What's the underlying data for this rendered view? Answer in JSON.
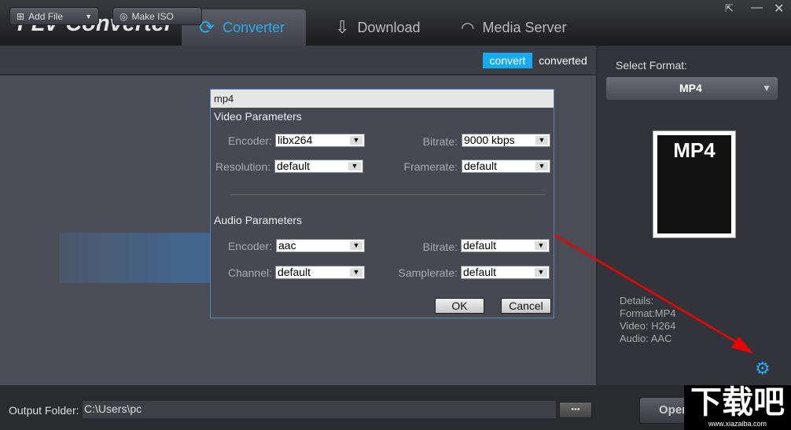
{
  "app": {
    "title": "FLV Converter"
  },
  "tabs": [
    {
      "label": "Converter",
      "icon": "refresh-icon"
    },
    {
      "label": "Download",
      "icon": "download-icon"
    },
    {
      "label": "Media Server",
      "icon": "wifi-icon"
    }
  ],
  "toolbar": {
    "add_file": "Add File",
    "make_iso": "Make ISO",
    "convert": "convert",
    "converted": "converted"
  },
  "sidebar": {
    "select_format_label": "Select Format:",
    "format": "MP4",
    "thumb_text": "MP4",
    "details": [
      "Details:",
      "Format:MP4",
      "Video: H264",
      "Audio: AAC"
    ]
  },
  "dialog": {
    "title": "mp4",
    "video_section": "Video Parameters",
    "audio_section": "Audio Parameters",
    "video": {
      "encoder_label": "Encoder:",
      "encoder": "libx264",
      "bitrate_label": "Bitrate:",
      "bitrate": "9000 kbps",
      "resolution_label": "Resolution:",
      "resolution": "default",
      "framerate_label": "Framerate:",
      "framerate": "default"
    },
    "audio": {
      "encoder_label": "Encoder:",
      "encoder": "aac",
      "bitrate_label": "Bitrate:",
      "bitrate": "default",
      "channel_label": "Channel:",
      "channel": "default",
      "samplerate_label": "Samplerate:",
      "samplerate": "default"
    },
    "ok": "OK",
    "cancel": "Cancel"
  },
  "bottom": {
    "output_label": "Output Folder:",
    "output_path": "C:\\Users\\pc",
    "browse": "•••",
    "open": "Open"
  },
  "watermark": {
    "text": "下载吧",
    "url": "www.xiazaiba.com"
  },
  "colors": {
    "accent": "#29a9f0",
    "arrow": "#e00000"
  }
}
